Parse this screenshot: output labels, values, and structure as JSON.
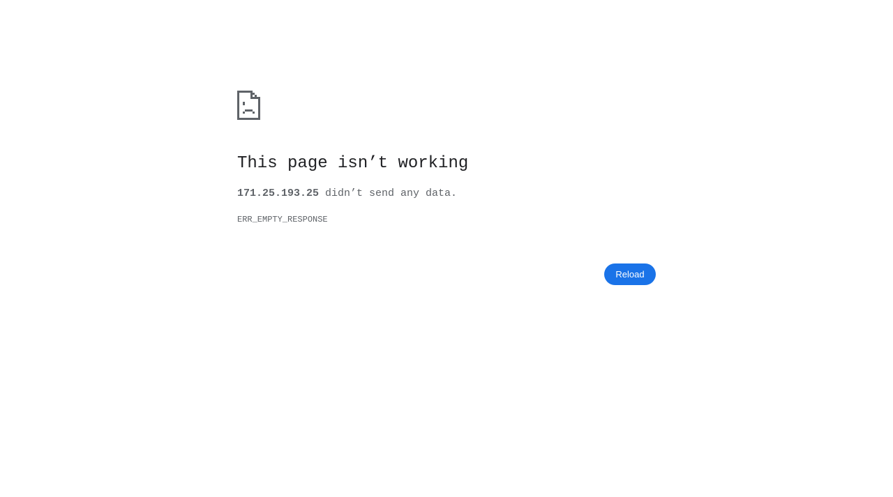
{
  "error": {
    "icon": "sad-page-icon",
    "title": "This page isn’t working",
    "host": "171.25.193.25",
    "message_suffix": " didn’t send any data.",
    "code": "ERR_EMPTY_RESPONSE",
    "reload_label": "Reload"
  },
  "colors": {
    "background": "#ffffff",
    "title_text": "#202124",
    "secondary_text": "#5f6368",
    "button_bg": "#1a73e8",
    "button_text": "#ffffff",
    "icon": "#5f6368"
  }
}
